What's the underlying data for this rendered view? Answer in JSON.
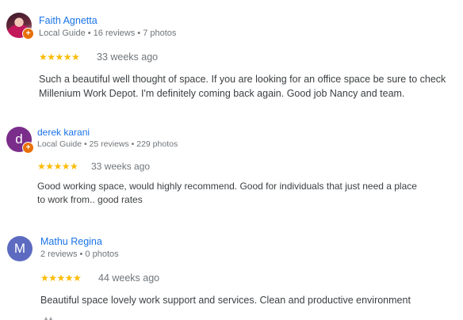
{
  "reviews": [
    {
      "name": "Faith Agnetta",
      "meta": "Local Guide • 16 reviews • 7 photos",
      "rating": 5,
      "stars": "★★★★★",
      "when": "33 weeks ago",
      "text": "Such a beautiful well thought of space. If you are looking for an office space be sure to check Millenium Work Depot. I'm definitely coming back again. Good job Nancy and team.",
      "avatar": "photo",
      "local_guide": true
    },
    {
      "name": "derek karani",
      "meta": "Local Guide • 25 reviews • 229 photos",
      "rating": 5,
      "stars": "★★★★★",
      "when": "33 weeks ago",
      "text": "Good working space, would highly recommend. Good for individuals that just need a place to work from.. good rates",
      "avatar_letter": "d",
      "avatar_color": "#7b2d8b",
      "local_guide": true
    },
    {
      "name": "Mathu Regina",
      "meta": "2 reviews • 0 photos",
      "rating": 5,
      "stars": "★★★★★",
      "when": "44 weeks ago",
      "text": "Beautiful space lovely work support and services. Clean and productive environment",
      "avatar_letter": "M",
      "avatar_color": "#5c6bc0",
      "local_guide": false
    }
  ],
  "icons": {
    "local_guide_badge": "local-guide-badge-icon",
    "star": "star-icon",
    "partial_action": "thumbs-up-icon"
  },
  "colors": {
    "name_link": "#1a73e8",
    "star": "#fbbc04",
    "meta": "#70757a",
    "body_text": "#3c4043",
    "local_guide_badge": "#e8710a"
  }
}
